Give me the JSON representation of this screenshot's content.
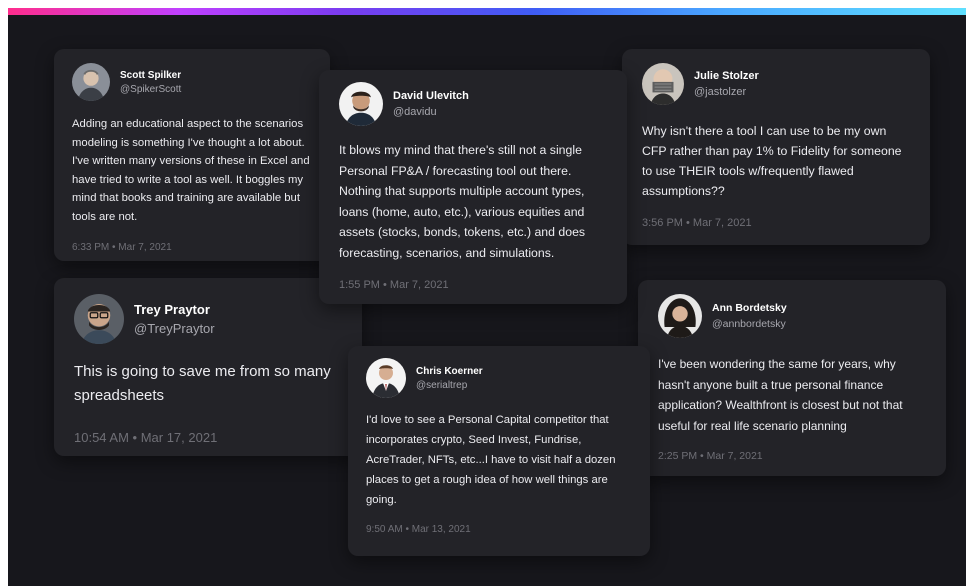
{
  "colors": {
    "background": "#17171c",
    "card": "#232328",
    "gradient": [
      "#ff2d8c",
      "#7a3cf0",
      "#3f5df5",
      "#5fe0ff"
    ]
  },
  "testimonials": {
    "scott": {
      "name": "Scott Spilker",
      "handle": "@SpikerScott",
      "text": "Adding an educational aspect to the scenarios modeling is something I've thought a lot about. I've written many versions of these in Excel and have tried to write a tool as well. It boggles my mind that books and training are available but tools are not.",
      "time": "6:33 PM • Mar 7, 2021",
      "avatar_icon": "avatar-photo"
    },
    "david": {
      "name": "David Ulevitch",
      "handle": "@davidu",
      "text": "It blows my mind that there's still not a single Personal FP&A / forecasting tool out there. Nothing that supports multiple account types, loans (home, auto, etc.), various equities and assets (stocks, bonds, tokens, etc.) and does forecasting, scenarios, and simulations.",
      "time": "1:55 PM • Mar 7, 2021",
      "avatar_icon": "avatar-photo"
    },
    "julie": {
      "name": "Julie Stolzer",
      "handle": "@jastolzer",
      "text": "Why isn't there a tool I can use to be my own CFP rather than pay 1% to Fidelity for someone to use THEIR tools w/frequently flawed assumptions??",
      "time": "3:56 PM • Mar 7, 2021",
      "avatar_icon": "avatar-photo"
    },
    "trey": {
      "name": "Trey Praytor",
      "handle": "@TreyPraytor",
      "text": "This is going to save me from so many spreadsheets",
      "time": "10:54 AM • Mar 17, 2021",
      "avatar_icon": "avatar-photo"
    },
    "chris": {
      "name": "Chris Koerner",
      "handle": "@serialtrep",
      "text": "I'd love to see a Personal Capital competitor that incorporates crypto, Seed Invest, Fundrise, AcreTrader, NFTs, etc...I have to visit half a dozen places to get a rough idea of how well things are going.",
      "time": "9:50 AM • Mar 13, 2021",
      "avatar_icon": "avatar-photo"
    },
    "ann": {
      "name": "Ann Bordetsky",
      "handle": "@annbordetsky",
      "text": "I've been wondering the same for years, why hasn't anyone built a true personal finance application? Wealthfront is closest but not that useful for real life scenario planning",
      "time": "2:25 PM • Mar 7, 2021",
      "avatar_icon": "avatar-photo"
    }
  }
}
